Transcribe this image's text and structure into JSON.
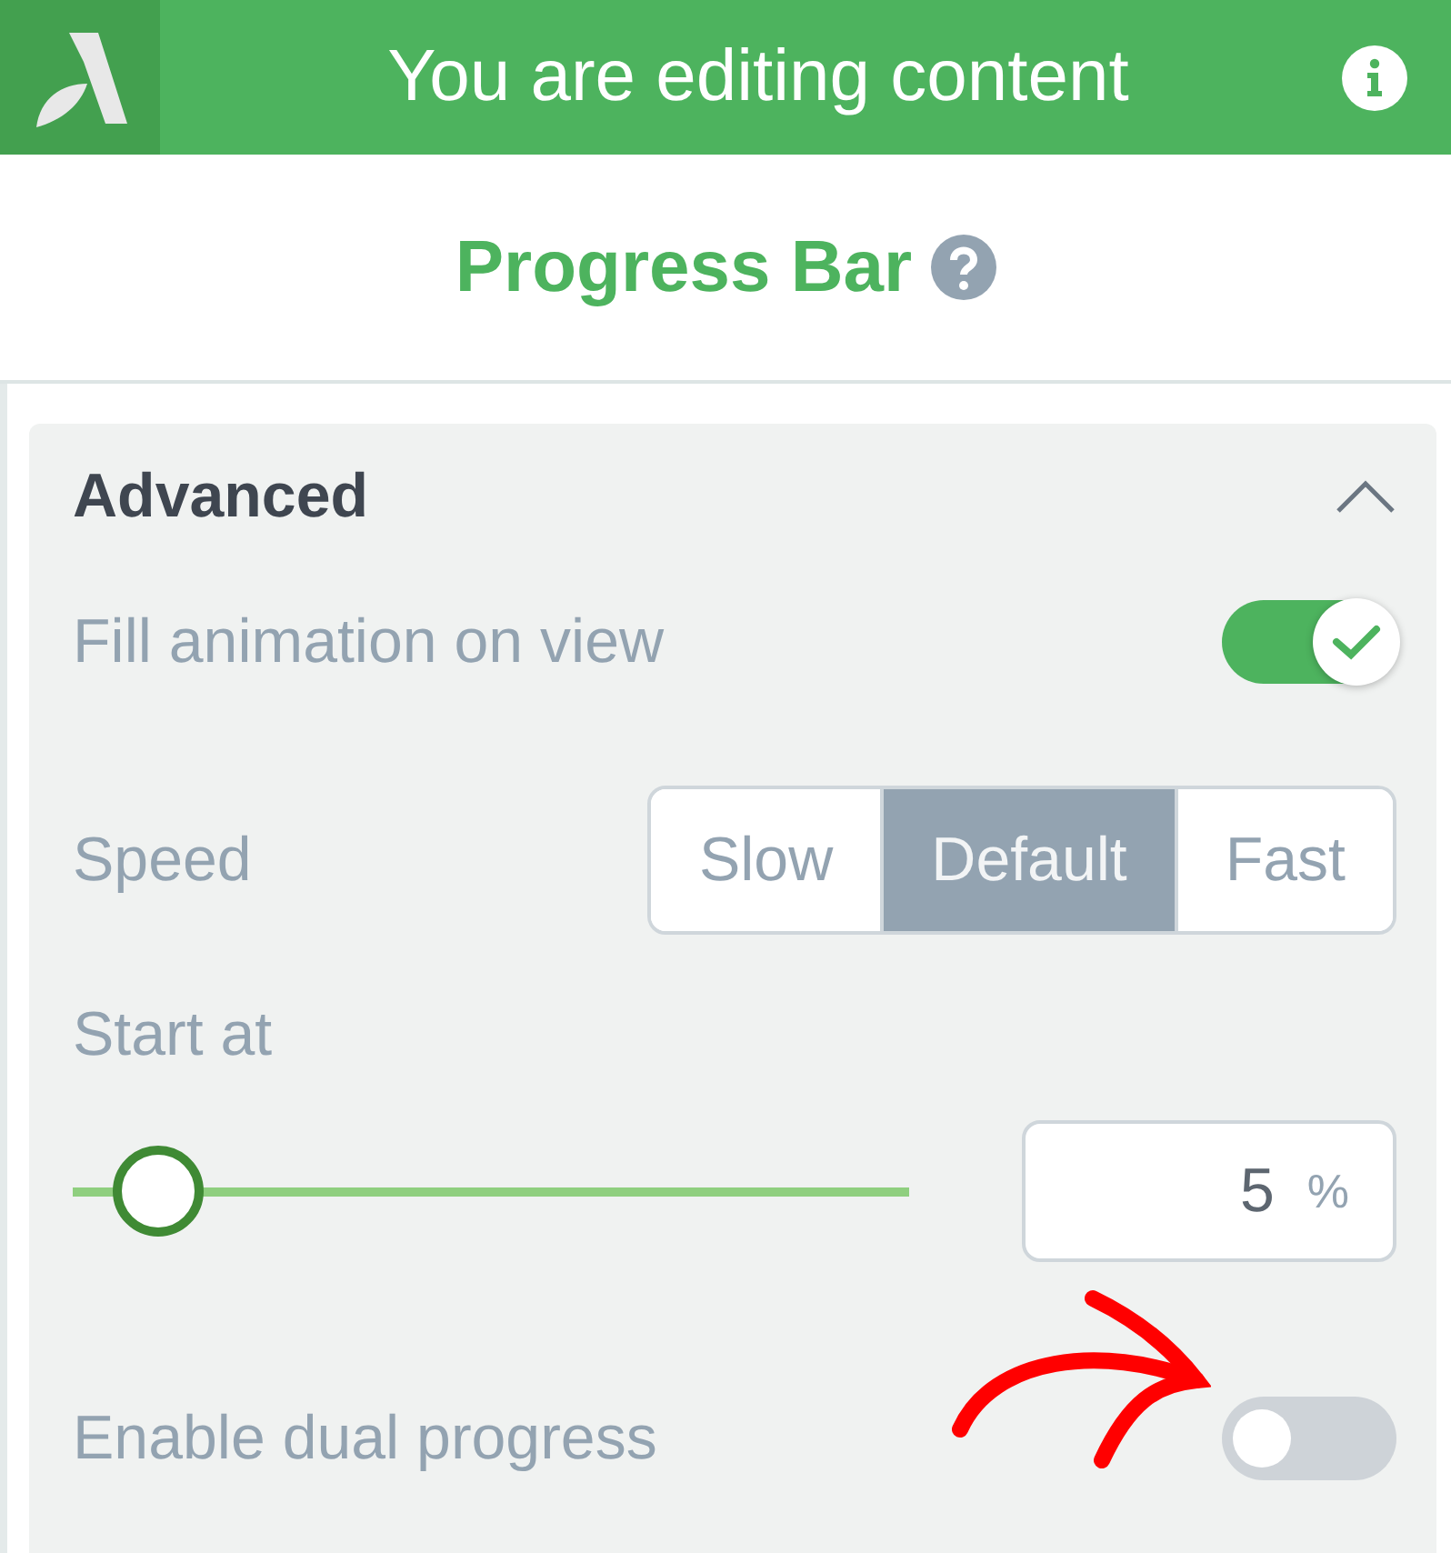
{
  "header": {
    "title": "You are editing content"
  },
  "block": {
    "title": "Progress Bar"
  },
  "section": {
    "title": "Advanced",
    "expanded": true
  },
  "settings": [
    {
      "kind": "toggle",
      "label": "Fill animation on view",
      "on": true
    },
    {
      "kind": "segmented",
      "label": "Speed",
      "options": [
        {
          "label": "Slow",
          "selected": false
        },
        {
          "label": "Default",
          "selected": true
        },
        {
          "label": "Fast",
          "selected": false
        }
      ]
    },
    {
      "kind": "slider",
      "label": "Start at",
      "level": 0.1,
      "value": "5",
      "unit": "%"
    },
    {
      "kind": "toggle",
      "label": "Enable dual progress",
      "on": false
    }
  ]
}
